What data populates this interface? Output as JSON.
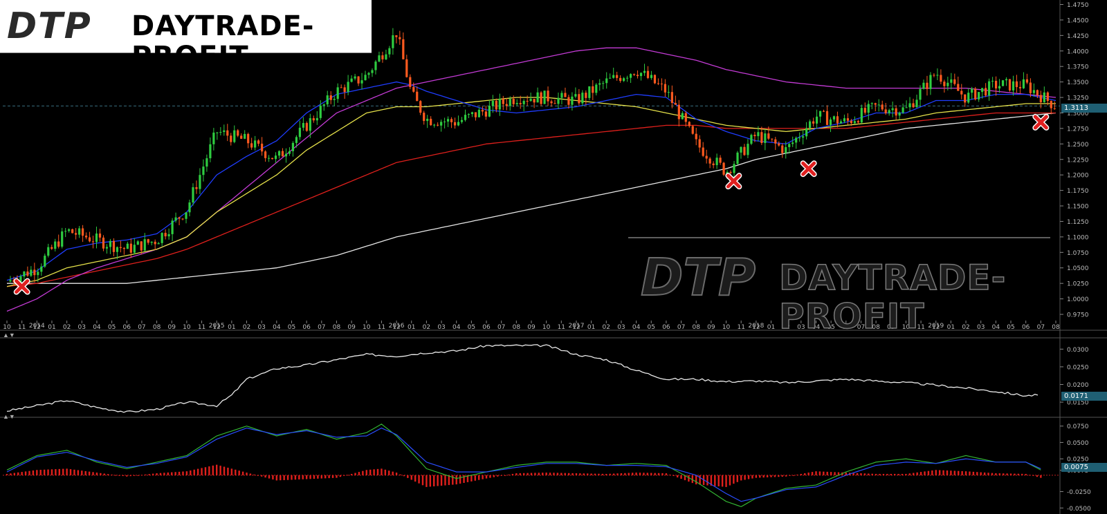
{
  "logo": {
    "mark": "DTP",
    "text": "DAYTRADE-PROFIT"
  },
  "watermark": {
    "mark": "DTP",
    "text": "DAYTRADE-PROFIT"
  },
  "price_panel": {
    "current_price_label": "1.3113",
    "current_price": 1.3113,
    "y_ticks": [
      "1.4750",
      "1.4500",
      "1.4250",
      "1.4000",
      "1.3750",
      "1.3500",
      "1.3250",
      "1.3000",
      "1.2750",
      "1.2500",
      "1.2250",
      "1.2000",
      "1.1750",
      "1.1500",
      "1.1250",
      "1.1000",
      "1.0750",
      "1.0500",
      "1.0250",
      "1.0000",
      "0.9750"
    ]
  },
  "time_axis": {
    "months": [
      "10",
      "11",
      "12",
      "01",
      "02",
      "03",
      "04",
      "05",
      "06",
      "07",
      "08",
      "09",
      "10",
      "11",
      "12",
      "01",
      "02",
      "03",
      "04",
      "05",
      "06",
      "07",
      "08",
      "09",
      "10",
      "11",
      "12",
      "01",
      "02",
      "03",
      "04",
      "05",
      "06",
      "07",
      "08",
      "09",
      "10",
      "11",
      "12",
      "01",
      "02",
      "03",
      "04",
      "05",
      "06",
      "07",
      "08",
      "09",
      "10",
      "11",
      "12",
      "01",
      "02",
      "03",
      "04",
      "05",
      "06",
      "07",
      "08",
      "09",
      "10",
      "11",
      "12",
      "01",
      "02",
      "03",
      "04",
      "05",
      "06",
      "07",
      "08"
    ],
    "years": [
      {
        "label": "2014",
        "month_index": 2
      },
      {
        "label": "2015",
        "month_index": 14
      },
      {
        "label": "2016",
        "month_index": 26
      },
      {
        "label": "2017",
        "month_index": 38
      },
      {
        "label": "2018",
        "month_index": 50
      },
      {
        "label": "2019",
        "month_index": 62
      }
    ]
  },
  "indicator1": {
    "value_label": "0.0171",
    "y_ticks": [
      "0.0300",
      "0.0250",
      "0.0200",
      "0.0150"
    ]
  },
  "indicator2": {
    "value_label": "0.0075",
    "y_ticks": [
      "0.0750",
      "0.0500",
      "0.0250",
      "0.0075",
      "-0.0250",
      "-0.0500"
    ]
  },
  "colors": {
    "background": "#000000",
    "candle_up": "#2ecc40",
    "candle_down": "#ff5a1f",
    "ma_blue": "#1f3dff",
    "ma_yellow": "#e6e24a",
    "ma_magenta": "#c43bd6",
    "ma_red": "#e0201c",
    "ma_white": "#e8e8e8",
    "macd_hist": "#e0201c",
    "macd_signal": "#33b533",
    "macd_line": "#2a4dff",
    "price_tag": "#1f5f73",
    "marker": "#e02020"
  },
  "chart_data": [
    {
      "type": "line",
      "name": "price",
      "x_months": [
        0,
        2,
        4,
        6,
        8,
        10,
        12,
        14,
        16,
        18,
        20,
        22,
        24,
        26,
        27,
        28,
        30,
        32,
        34,
        36,
        38,
        40,
        42,
        44,
        46,
        48,
        50,
        52,
        54,
        56,
        58,
        60,
        62,
        64,
        66,
        68,
        70
      ],
      "close": [
        1.028,
        1.05,
        1.11,
        1.095,
        1.08,
        1.095,
        1.145,
        1.27,
        1.255,
        1.225,
        1.28,
        1.335,
        1.36,
        1.43,
        1.33,
        1.29,
        1.285,
        1.305,
        1.325,
        1.325,
        1.32,
        1.35,
        1.37,
        1.335,
        1.25,
        1.205,
        1.265,
        1.24,
        1.295,
        1.285,
        1.31,
        1.305,
        1.365,
        1.325,
        1.345,
        1.345,
        1.311
      ],
      "ylim": [
        0.965,
        1.48
      ],
      "moving_averages": {
        "blue": [
          1.03,
          1.045,
          1.08,
          1.09,
          1.095,
          1.105,
          1.14,
          1.2,
          1.23,
          1.255,
          1.3,
          1.33,
          1.34,
          1.35,
          1.345,
          1.335,
          1.32,
          1.305,
          1.3,
          1.305,
          1.31,
          1.32,
          1.33,
          1.325,
          1.29,
          1.27,
          1.255,
          1.25,
          1.275,
          1.285,
          1.3,
          1.3,
          1.32,
          1.32,
          1.33,
          1.33,
          1.32
        ],
        "yellow": [
          1.02,
          1.03,
          1.05,
          1.06,
          1.07,
          1.08,
          1.1,
          1.14,
          1.17,
          1.2,
          1.24,
          1.27,
          1.3,
          1.31,
          1.31,
          1.31,
          1.315,
          1.32,
          1.325,
          1.325,
          1.32,
          1.315,
          1.31,
          1.3,
          1.29,
          1.28,
          1.275,
          1.27,
          1.275,
          1.28,
          1.285,
          1.29,
          1.3,
          1.305,
          1.31,
          1.315,
          1.315
        ],
        "magenta": [
          0.98,
          1.0,
          1.03,
          1.05,
          1.065,
          1.08,
          1.1,
          1.14,
          1.18,
          1.22,
          1.26,
          1.3,
          1.32,
          1.34,
          1.345,
          1.35,
          1.36,
          1.37,
          1.38,
          1.39,
          1.4,
          1.405,
          1.405,
          1.395,
          1.385,
          1.37,
          1.36,
          1.35,
          1.345,
          1.34,
          1.34,
          1.34,
          1.34,
          1.34,
          1.335,
          1.33,
          1.325
        ],
        "red": [
          1.02,
          1.025,
          1.035,
          1.045,
          1.055,
          1.065,
          1.08,
          1.1,
          1.12,
          1.14,
          1.16,
          1.18,
          1.2,
          1.22,
          1.225,
          1.23,
          1.24,
          1.25,
          1.255,
          1.26,
          1.265,
          1.27,
          1.275,
          1.28,
          1.28,
          1.275,
          1.275,
          1.275,
          1.275,
          1.275,
          1.28,
          1.285,
          1.29,
          1.295,
          1.3,
          1.3,
          1.3
        ],
        "white": [
          1.025,
          1.025,
          1.025,
          1.025,
          1.025,
          1.03,
          1.035,
          1.04,
          1.045,
          1.05,
          1.06,
          1.07,
          1.085,
          1.1,
          1.105,
          1.11,
          1.12,
          1.13,
          1.14,
          1.15,
          1.16,
          1.17,
          1.18,
          1.19,
          1.2,
          1.21,
          1.225,
          1.235,
          1.245,
          1.255,
          1.265,
          1.275,
          1.28,
          1.285,
          1.29,
          1.295,
          1.3
        ]
      },
      "markers": [
        {
          "month": 1,
          "price": 1.02
        },
        {
          "month": 48.5,
          "price": 1.19
        },
        {
          "month": 53.5,
          "price": 1.21
        },
        {
          "month": 69,
          "price": 1.285
        }
      ]
    },
    {
      "type": "line",
      "name": "indicator1",
      "x_months": [
        0,
        4,
        6,
        8,
        10,
        12,
        14,
        15,
        16,
        18,
        20,
        22,
        24,
        26,
        28,
        30,
        32,
        36,
        38,
        40,
        42,
        44,
        46,
        48,
        50,
        52,
        54,
        56,
        58,
        60,
        62,
        64,
        66,
        68,
        69
      ],
      "values": [
        0.0125,
        0.0155,
        0.0135,
        0.0122,
        0.013,
        0.015,
        0.014,
        0.017,
        0.0215,
        0.0245,
        0.0255,
        0.027,
        0.0285,
        0.028,
        0.029,
        0.0295,
        0.031,
        0.031,
        0.0285,
        0.027,
        0.024,
        0.0215,
        0.0215,
        0.0208,
        0.021,
        0.0205,
        0.021,
        0.0215,
        0.021,
        0.0205,
        0.0198,
        0.019,
        0.018,
        0.0168,
        0.0171
      ],
      "ylim": [
        0.0115,
        0.033
      ]
    },
    {
      "type": "bar",
      "name": "indicator2",
      "x_months": [
        0,
        2,
        4,
        6,
        8,
        10,
        12,
        14,
        16,
        18,
        20,
        22,
        24,
        25,
        26,
        28,
        30,
        32,
        34,
        36,
        38,
        40,
        42,
        44,
        46,
        48,
        49,
        50,
        52,
        54,
        56,
        58,
        60,
        62,
        64,
        66,
        68,
        69
      ],
      "histogram": [
        0.002,
        0.008,
        0.01,
        0.004,
        -0.002,
        0.003,
        0.006,
        0.016,
        0.004,
        -0.008,
        -0.006,
        -0.004,
        0.008,
        0.01,
        0.004,
        -0.018,
        -0.014,
        -0.005,
        0.003,
        0.004,
        0.003,
        0.002,
        0.004,
        0.003,
        -0.014,
        -0.018,
        -0.008,
        -0.004,
        -0.002,
        0.006,
        0.004,
        0.002,
        0.002,
        0.008,
        0.006,
        0.003,
        0.002,
        -0.004
      ],
      "signal": [
        0.008,
        0.03,
        0.038,
        0.02,
        0.01,
        0.02,
        0.03,
        0.06,
        0.075,
        0.06,
        0.07,
        0.055,
        0.065,
        0.078,
        0.06,
        0.01,
        -0.005,
        0.005,
        0.015,
        0.02,
        0.02,
        0.015,
        0.018,
        0.015,
        -0.01,
        -0.04,
        -0.048,
        -0.035,
        -0.02,
        -0.015,
        0.005,
        0.02,
        0.025,
        0.018,
        0.03,
        0.02,
        0.02,
        0.008
      ],
      "macd": [
        0.005,
        0.028,
        0.035,
        0.022,
        0.012,
        0.018,
        0.028,
        0.055,
        0.072,
        0.062,
        0.068,
        0.058,
        0.06,
        0.072,
        0.062,
        0.02,
        0.005,
        0.005,
        0.012,
        0.018,
        0.018,
        0.015,
        0.015,
        0.013,
        0.0,
        -0.028,
        -0.04,
        -0.035,
        -0.022,
        -0.018,
        0.0,
        0.015,
        0.02,
        0.018,
        0.025,
        0.02,
        0.02,
        0.01
      ],
      "ylim": [
        -0.055,
        0.08
      ]
    }
  ]
}
